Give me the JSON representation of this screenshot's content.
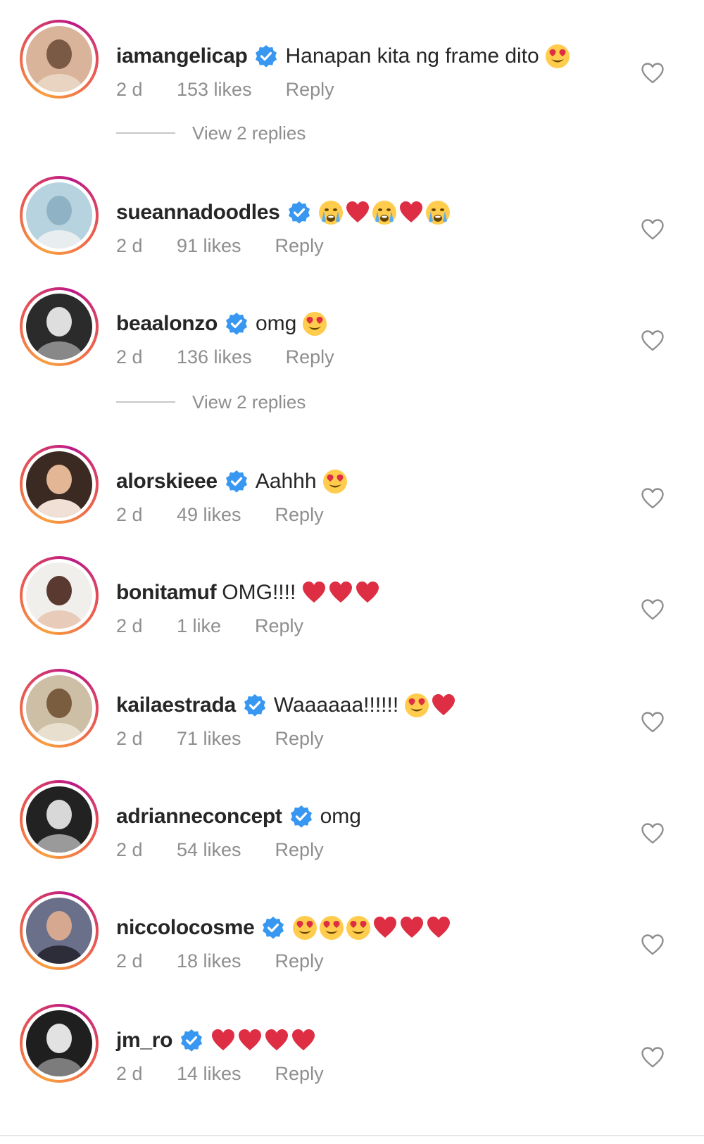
{
  "comments": [
    {
      "username": "iamangelicap",
      "verified": true,
      "text": "Hanapan kita ng frame dito",
      "emojis": [
        "heart-eyes"
      ],
      "time": "2 d",
      "likes": "153 likes",
      "reply": "Reply"
    },
    {
      "username": "sueannadoodles",
      "verified": true,
      "text": "",
      "emojis": [
        "crying",
        "red-heart",
        "crying",
        "red-heart",
        "crying"
      ],
      "time": "2 d",
      "likes": "91 likes",
      "reply": "Reply"
    },
    {
      "username": "beaalonzo",
      "verified": true,
      "text": "omg",
      "emojis": [
        "heart-eyes"
      ],
      "time": "2 d",
      "likes": "136 likes",
      "reply": "Reply"
    },
    {
      "username": "alorskieee",
      "verified": true,
      "text": "Aahhh",
      "emojis": [
        "heart-eyes"
      ],
      "time": "2 d",
      "likes": "49 likes",
      "reply": "Reply"
    },
    {
      "username": "bonitamuf",
      "verified": false,
      "text": "OMG!!!!",
      "emojis": [
        "red-heart",
        "red-heart",
        "red-heart"
      ],
      "time": "2 d",
      "likes": "1 like",
      "reply": "Reply"
    },
    {
      "username": "kailaestrada",
      "verified": true,
      "text": "Waaaaaa!!!!!!",
      "emojis": [
        "heart-eyes",
        "red-heart"
      ],
      "time": "2 d",
      "likes": "71 likes",
      "reply": "Reply"
    },
    {
      "username": "adrianneconcept",
      "verified": true,
      "text": "omg",
      "emojis": [],
      "time": "2 d",
      "likes": "54 likes",
      "reply": "Reply"
    },
    {
      "username": "niccolocosme",
      "verified": true,
      "text": "",
      "emojis": [
        "heart-eyes",
        "heart-eyes",
        "heart-eyes",
        "red-heart",
        "red-heart",
        "red-heart"
      ],
      "time": "2 d",
      "likes": "18 likes",
      "reply": "Reply"
    },
    {
      "username": "jm_ro",
      "verified": true,
      "text": "",
      "emojis": [
        "red-heart",
        "red-heart",
        "red-heart",
        "red-heart"
      ],
      "time": "2 d",
      "likes": "14 likes",
      "reply": "Reply"
    }
  ],
  "view_replies": [
    {
      "after_comment": 0,
      "label": "View 2 replies"
    },
    {
      "after_comment": 2,
      "label": "View 2 replies"
    }
  ],
  "colors": {
    "verified_blue": "#3897f0",
    "meta_gray": "#8e8e8e",
    "heart_red": "#ed4956",
    "emoji_yellow": "#ffcc4d"
  }
}
